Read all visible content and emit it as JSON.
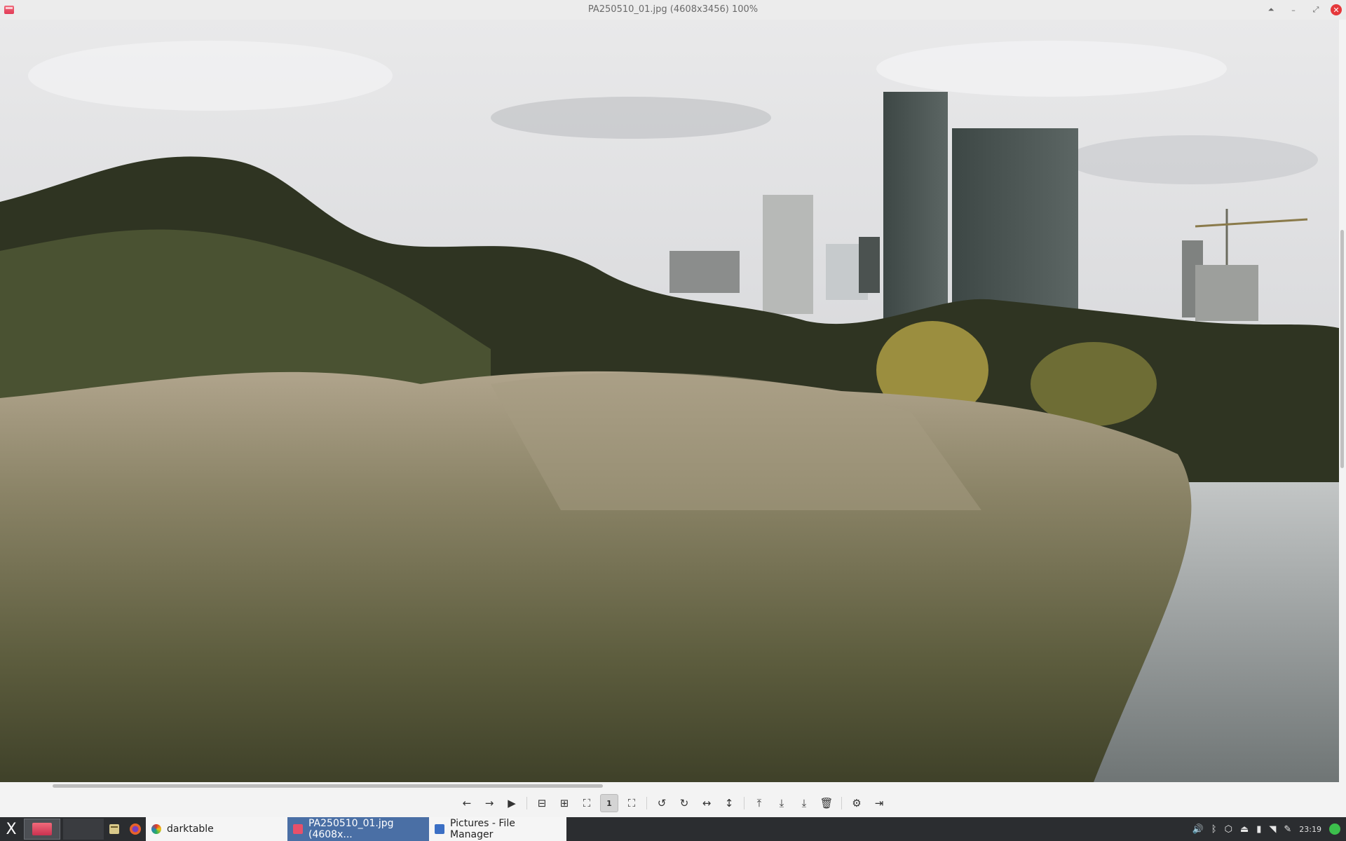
{
  "window": {
    "title": "PA250510_01.jpg (4608x3456) 100%",
    "controls": [
      "shade-icon",
      "minimize-icon",
      "maximize-icon",
      "close-icon"
    ]
  },
  "toolbar": {
    "buttons": [
      {
        "name": "back-button",
        "icon": "arrow-left-icon"
      },
      {
        "name": "forward-button",
        "icon": "arrow-right-icon"
      },
      {
        "name": "slideshow-button",
        "icon": "play-icon"
      },
      {
        "name": "zoom-out-button",
        "icon": "zoom-out-icon"
      },
      {
        "name": "zoom-in-button",
        "icon": "zoom-in-icon"
      },
      {
        "name": "fit-window-button",
        "icon": "fit-icon"
      },
      {
        "name": "actual-size-button",
        "icon": "one-to-one-icon",
        "active": true
      },
      {
        "name": "fullscreen-button",
        "icon": "fullscreen-icon"
      },
      {
        "name": "rotate-left-button",
        "icon": "rotate-ccw-icon"
      },
      {
        "name": "rotate-right-button",
        "icon": "rotate-cw-icon"
      },
      {
        "name": "flip-horizontal-button",
        "icon": "flip-h-icon"
      },
      {
        "name": "flip-vertical-button",
        "icon": "flip-v-icon"
      },
      {
        "name": "open-button",
        "icon": "upload-icon"
      },
      {
        "name": "save-button",
        "icon": "download-icon"
      },
      {
        "name": "save-as-button",
        "icon": "save-as-icon"
      },
      {
        "name": "delete-button",
        "icon": "trash-icon"
      },
      {
        "name": "preferences-button",
        "icon": "gear-icon"
      },
      {
        "name": "quit-button",
        "icon": "exit-icon"
      }
    ]
  },
  "taskbar": {
    "menu_icon": "X",
    "tasks": [
      {
        "label": "darktable",
        "style": "light",
        "icon_color": "#e0342c"
      },
      {
        "label": "PA250510_01.jpg (4608x...",
        "style": "active",
        "icon_color": "#e8506a"
      },
      {
        "label": "Pictures - File Manager",
        "style": "light",
        "icon_color": "#3b6fc4"
      }
    ],
    "tray": {
      "clock": "23:19"
    }
  },
  "colors": {
    "close_button": "#e5383b",
    "taskbar_bg": "#2b2d30",
    "active_task": "#4a6fa5"
  }
}
